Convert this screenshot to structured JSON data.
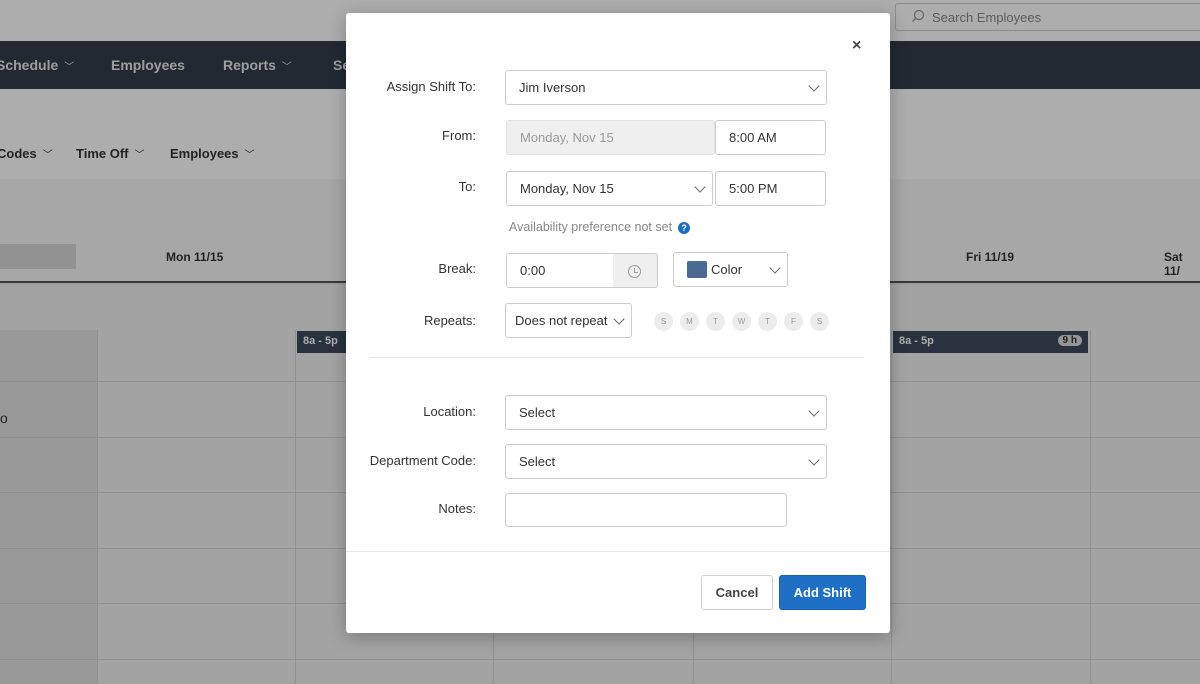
{
  "background": {
    "search_placeholder": "Search Employees",
    "nav": [
      {
        "label": "Schedule"
      },
      {
        "label": "Employees"
      },
      {
        "label": "Reports"
      },
      {
        "label": "Se"
      }
    ],
    "subnav": [
      {
        "label": "Codes"
      },
      {
        "label": "Time Off"
      },
      {
        "label": "Employees"
      }
    ],
    "days": [
      "Mon 11/15",
      "Fri 11/19",
      "Sat 11/"
    ],
    "shifts": [
      {
        "label": "8a - 5p",
        "hours": ""
      },
      {
        "label": "8a - 5p",
        "hours": "9 h"
      }
    ],
    "row_glyph": "o"
  },
  "modal": {
    "close_label": "×",
    "assign": {
      "label": "Assign Shift To:",
      "value": "Jim Iverson"
    },
    "from": {
      "label": "From:",
      "date": "Monday, Nov 15",
      "time": "8:00 AM"
    },
    "to": {
      "label": "To:",
      "date": "Monday, Nov 15",
      "time": "5:00 PM"
    },
    "availability_note": "Availability preference not set",
    "help_icon_glyph": "?",
    "brk": {
      "label": "Break:",
      "value": "0:00"
    },
    "color": {
      "label": "Color",
      "value": "#4a6a92"
    },
    "repeats": {
      "label": "Repeats:",
      "value": "Does not repeat"
    },
    "weekdays": [
      "S",
      "M",
      "T",
      "W",
      "T",
      "F",
      "S"
    ],
    "location": {
      "label": "Location:",
      "value": "Select"
    },
    "department": {
      "label": "Department Code:",
      "value": "Select"
    },
    "notes": {
      "label": "Notes:",
      "value": ""
    },
    "cancel_label": "Cancel",
    "submit_label": "Add Shift"
  }
}
